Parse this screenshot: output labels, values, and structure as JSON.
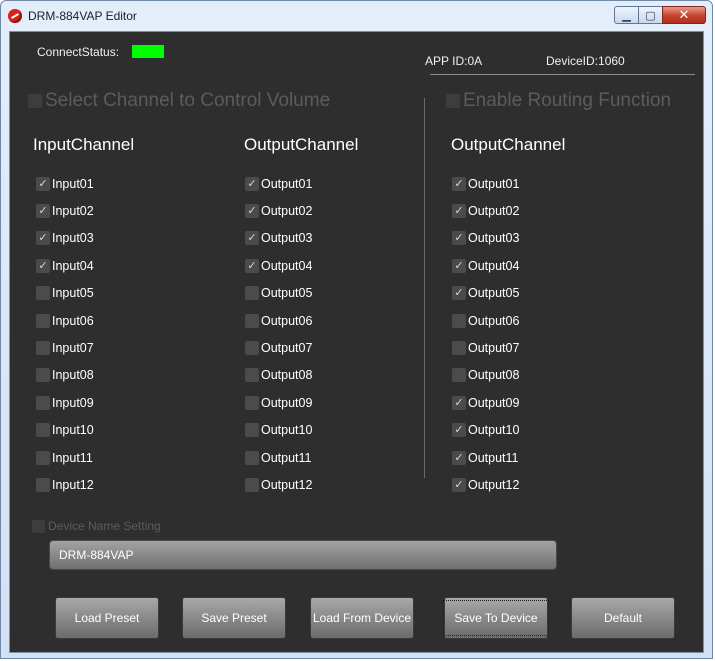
{
  "window": {
    "title": "DRM-884VAP Editor",
    "buttons": [
      "minimize",
      "maximize",
      "close"
    ]
  },
  "status": {
    "connect_label": "ConnectStatus:",
    "connect_color": "#00ff00",
    "app_id": "APP ID:0A",
    "device_id": "DeviceID:1060"
  },
  "volume_section": {
    "label": "Select Channel to Control Volume",
    "checked": false
  },
  "routing_section": {
    "label": "Enable Routing Function",
    "checked": false
  },
  "columns": [
    {
      "title": "InputChannel",
      "items": [
        {
          "label": "Input01",
          "checked": true
        },
        {
          "label": "Input02",
          "checked": true
        },
        {
          "label": "Input03",
          "checked": true
        },
        {
          "label": "Input04",
          "checked": true
        },
        {
          "label": "Input05",
          "checked": false
        },
        {
          "label": "Input06",
          "checked": false
        },
        {
          "label": "Input07",
          "checked": false
        },
        {
          "label": "Input08",
          "checked": false
        },
        {
          "label": "Input09",
          "checked": false
        },
        {
          "label": "Input10",
          "checked": false
        },
        {
          "label": "Input11",
          "checked": false
        },
        {
          "label": "Input12",
          "checked": false
        }
      ]
    },
    {
      "title": "OutputChannel",
      "items": [
        {
          "label": "Output01",
          "checked": true
        },
        {
          "label": "Output02",
          "checked": true
        },
        {
          "label": "Output03",
          "checked": true
        },
        {
          "label": "Output04",
          "checked": true
        },
        {
          "label": "Output05",
          "checked": false
        },
        {
          "label": "Output06",
          "checked": false
        },
        {
          "label": "Output07",
          "checked": false
        },
        {
          "label": "Output08",
          "checked": false
        },
        {
          "label": "Output09",
          "checked": false
        },
        {
          "label": "Output10",
          "checked": false
        },
        {
          "label": "Output11",
          "checked": false
        },
        {
          "label": "Output12",
          "checked": false
        }
      ]
    },
    {
      "title": "OutputChannel",
      "items": [
        {
          "label": "Output01",
          "checked": true
        },
        {
          "label": "Output02",
          "checked": true
        },
        {
          "label": "Output03",
          "checked": true
        },
        {
          "label": "Output04",
          "checked": true
        },
        {
          "label": "Output05",
          "checked": true
        },
        {
          "label": "Output06",
          "checked": false
        },
        {
          "label": "Output07",
          "checked": false
        },
        {
          "label": "Output08",
          "checked": false
        },
        {
          "label": "Output09",
          "checked": true
        },
        {
          "label": "Output10",
          "checked": true
        },
        {
          "label": "Output11",
          "checked": true
        },
        {
          "label": "Output12",
          "checked": true
        }
      ]
    }
  ],
  "device_name": {
    "label": "Device Name Setting",
    "checked": false,
    "value": "DRM-884VAP"
  },
  "buttons": {
    "load_preset": "Load Preset",
    "save_preset": "Save Preset",
    "load_from_device": "Load From Device",
    "save_to_device": "Save To Device",
    "default": "Default"
  }
}
